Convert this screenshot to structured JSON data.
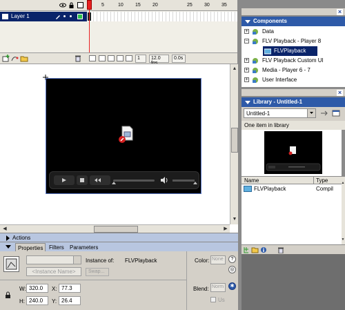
{
  "timeline": {
    "frame_numbers": [
      "1",
      "5",
      "10",
      "15",
      "20",
      "25",
      "30",
      "35"
    ],
    "layer_name": "Layer 1",
    "current_frame": "1",
    "frame_rate": "12.0 fps",
    "elapsed": "0.0s"
  },
  "components_panel": {
    "title": "Components",
    "items": [
      {
        "label": "Data",
        "expanded": false
      },
      {
        "label": "FLV Playback - Player 8",
        "expanded": true
      },
      {
        "label": "FLVPlayback",
        "child": true,
        "selected": true
      },
      {
        "label": "FLV Playback Custom UI",
        "expanded": false
      },
      {
        "label": "Media - Player 6 - 7",
        "expanded": false
      },
      {
        "label": "User Interface",
        "expanded": false
      }
    ]
  },
  "library_panel": {
    "title": "Library - Untitled-1",
    "document": "Untitled-1",
    "count_text": "One item in library",
    "columns": {
      "name": "Name",
      "type": "Type"
    },
    "items": [
      {
        "name": "FLVPlayback",
        "type": "Compil"
      }
    ]
  },
  "actions_bar": {
    "label": "Actions"
  },
  "properties": {
    "tabs": [
      "Properties",
      "Filters",
      "Parameters"
    ],
    "instance_name_placeholder": "<Instance Name>",
    "instance_of_label": "Instance of:",
    "instance_of_value": "FLVPlayback",
    "swap_label": "Swap...",
    "color_label": "Color:",
    "color_value": "None",
    "blend_label": "Blend:",
    "blend_value": "Norm",
    "use_label": "Us",
    "w_label": "W:",
    "w_value": "320.0",
    "x_label": "X:",
    "x_value": "77.3",
    "h_label": "H:",
    "h_value": "240.0",
    "y_label": "Y:",
    "y_value": "26.4"
  }
}
